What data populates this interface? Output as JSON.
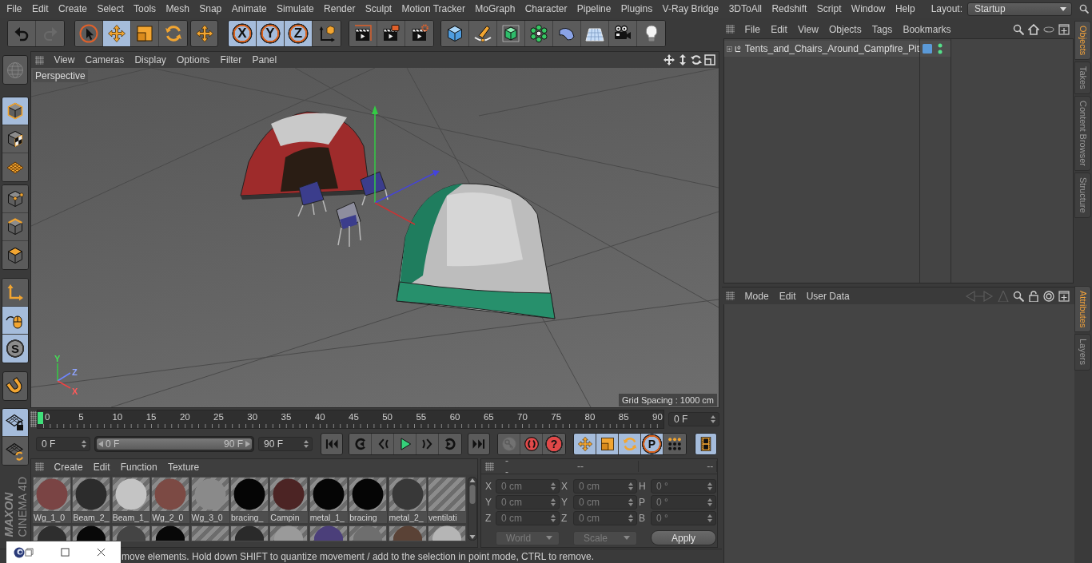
{
  "menu_bar": {
    "items": [
      "File",
      "Edit",
      "Create",
      "Select",
      "Tools",
      "Mesh",
      "Snap",
      "Animate",
      "Simulate",
      "Render",
      "Sculpt",
      "Motion Tracker",
      "MoGraph",
      "Character",
      "Pipeline",
      "Plugins",
      "V-Ray Bridge",
      "3DToAll",
      "Redshift",
      "Script",
      "Window",
      "Help"
    ],
    "layout_label": "Layout:",
    "layout_value": "Startup"
  },
  "toolbar": [
    [
      {
        "kind": "undo",
        "selected": false,
        "disabled": false
      },
      {
        "kind": "redo",
        "selected": false,
        "disabled": true
      }
    ],
    [
      {
        "kind": "select",
        "selected": false,
        "disabled": false
      },
      {
        "kind": "move",
        "selected": true,
        "disabled": false
      },
      {
        "kind": "scale",
        "selected": false,
        "disabled": false
      },
      {
        "kind": "rotate",
        "selected": false,
        "disabled": false
      }
    ],
    [
      {
        "kind": "move",
        "selected": false,
        "disabled": false
      }
    ],
    [
      {
        "kind": "axis",
        "label": "X",
        "selected": true,
        "disabled": false
      },
      {
        "kind": "axis",
        "label": "Y",
        "selected": true,
        "disabled": false
      },
      {
        "kind": "axis",
        "label": "Z",
        "selected": true,
        "disabled": false
      },
      {
        "kind": "coordinates",
        "selected": false,
        "disabled": false
      }
    ],
    [
      {
        "kind": "render-view",
        "selected": false,
        "disabled": false
      },
      {
        "kind": "render-viewer",
        "selected": false,
        "disabled": false
      },
      {
        "kind": "render-settings",
        "selected": false,
        "disabled": false
      }
    ],
    [
      {
        "kind": "cube",
        "selected": false,
        "disabled": false
      },
      {
        "kind": "pen",
        "selected": false,
        "disabled": false
      },
      {
        "kind": "subdivision",
        "selected": false,
        "disabled": false
      },
      {
        "kind": "cloner",
        "selected": false,
        "disabled": false
      },
      {
        "kind": "deformer",
        "selected": false,
        "disabled": false
      },
      {
        "kind": "floor",
        "selected": false,
        "disabled": false
      },
      {
        "kind": "camera",
        "selected": false,
        "disabled": false
      },
      {
        "kind": "light",
        "selected": false,
        "disabled": false
      }
    ]
  ],
  "side_toolbar": [
    [
      {
        "kind": "globe",
        "selected": false,
        "disabled": true
      }
    ],
    [
      {
        "kind": "model",
        "selected": true,
        "disabled": false
      },
      {
        "kind": "texture",
        "selected": false,
        "disabled": false
      },
      {
        "kind": "workplane",
        "selected": false,
        "disabled": false
      }
    ],
    [
      {
        "kind": "points",
        "selected": false,
        "disabled": false
      },
      {
        "kind": "edges",
        "selected": false,
        "disabled": false
      },
      {
        "kind": "polygons",
        "selected": false,
        "disabled": false
      }
    ],
    [
      {
        "kind": "axis-mode",
        "selected": false,
        "disabled": false
      },
      {
        "kind": "tweak",
        "selected": true,
        "disabled": false
      },
      {
        "kind": "snap",
        "label": "S",
        "selected": true,
        "disabled": false
      }
    ],
    [
      {
        "kind": "magnet",
        "selected": false,
        "disabled": false
      }
    ],
    [
      {
        "kind": "grid-lock",
        "selected": true,
        "disabled": false
      },
      {
        "kind": "grid-refresh",
        "selected": false,
        "disabled": false
      }
    ]
  ],
  "logo": {
    "brand": "MAXON",
    "product": "CINEMA 4D"
  },
  "viewport": {
    "menu": [
      "View",
      "Cameras",
      "Display",
      "Options",
      "Filter",
      "Panel"
    ],
    "camera": "Perspective",
    "grid_spacing": "Grid Spacing : 1000 cm",
    "axis_labels": [
      "Y",
      "Z",
      "X"
    ]
  },
  "timeline": {
    "level": 0,
    "ticks": [
      "0",
      "5",
      "10",
      "15",
      "20",
      "25",
      "30",
      "35",
      "40",
      "45",
      "50",
      "55",
      "60",
      "65",
      "70",
      "75",
      "80",
      "85",
      "90"
    ],
    "current_frame": "0 F"
  },
  "transport": {
    "start": "0 F",
    "range": {
      "start": "0 F",
      "end": "90 F",
      "level": 1
    },
    "end": "90 F",
    "groups": [
      [
        {
          "kind": "first",
          "selected": false,
          "disabled": false
        }
      ],
      [
        {
          "kind": "prev-key",
          "selected": false,
          "disabled": false
        },
        {
          "kind": "prev-frame",
          "selected": false,
          "disabled": false
        },
        {
          "kind": "play",
          "selected": false,
          "disabled": false
        },
        {
          "kind": "next-frame",
          "selected": false,
          "disabled": false
        },
        {
          "kind": "next-key",
          "selected": false,
          "disabled": false
        }
      ],
      [
        {
          "kind": "last",
          "selected": false,
          "disabled": false
        }
      ],
      [
        {
          "kind": "record",
          "selected": false,
          "disabled": true
        },
        {
          "kind": "autokey",
          "selected": false,
          "disabled": false
        },
        {
          "kind": "help",
          "label": "?",
          "selected": false,
          "disabled": false
        }
      ],
      [
        {
          "kind": "move",
          "selected": true,
          "disabled": false
        },
        {
          "kind": "scale",
          "selected": true,
          "disabled": false
        },
        {
          "kind": "rotate",
          "selected": true,
          "disabled": false
        },
        {
          "kind": "keyframe",
          "label": "P",
          "selected": true,
          "disabled": false
        },
        {
          "kind": "points-grid",
          "selected": false,
          "disabled": false
        }
      ],
      [
        {
          "kind": "timeline",
          "selected": true,
          "disabled": false
        }
      ]
    ]
  },
  "material_manager": {
    "menu": [
      "Create",
      "Edit",
      "Function",
      "Texture"
    ],
    "materials": [
      {
        "label": "Wg_1_0",
        "kind": "sphere",
        "color": "#7a4444"
      },
      {
        "label": "Beam_2_",
        "kind": "sphere",
        "color": "#2c2c2c"
      },
      {
        "label": "Beam_1_",
        "kind": "sphere",
        "color": "#c4c4c4"
      },
      {
        "label": "Wg_2_0",
        "kind": "sphere",
        "color": "#7c4a44"
      },
      {
        "label": "Wg_3_0",
        "kind": "sphere",
        "color": "#8a8a8a"
      },
      {
        "label": "bracing_",
        "kind": "sphere",
        "color": "#050505"
      },
      {
        "label": "Campin",
        "kind": "sphere",
        "color": "#4c2424"
      },
      {
        "label": "metal_1_",
        "kind": "sphere",
        "color": "#050505"
      },
      {
        "label": "bracing",
        "kind": "sphere",
        "color": "#050505"
      },
      {
        "label": "metal_2_",
        "kind": "sphere",
        "color": "#383838"
      },
      {
        "label": "ventilati",
        "kind": "transparent"
      },
      {
        "kind": "sphere",
        "color": "#2e2e2e"
      },
      {
        "kind": "sphere",
        "color": "#080808"
      },
      {
        "kind": "sphere",
        "color": "#444444"
      },
      {
        "kind": "sphere",
        "color": "#080808"
      },
      {
        "kind": "transparent"
      },
      {
        "kind": "sphere",
        "color": "#2a2a2a"
      },
      {
        "kind": "sphere",
        "color": "#9a9a9a"
      },
      {
        "kind": "sphere",
        "color": "#4b3f7a"
      },
      {
        "kind": "sphere",
        "color": "#6e6e6e"
      },
      {
        "kind": "sphere",
        "color": "#5a4236"
      },
      {
        "kind": "sphere",
        "color": "#b5b5b5"
      }
    ]
  },
  "coordinates": {
    "disabled": true,
    "headers": [
      "--",
      "--",
      "--"
    ],
    "rows": [
      [
        {
          "axis": "X",
          "value": "0 cm"
        },
        {
          "axis": "X",
          "value": "0 cm"
        },
        {
          "axis": "H",
          "value": "0 °"
        }
      ],
      [
        {
          "axis": "Y",
          "value": "0 cm"
        },
        {
          "axis": "Y",
          "value": "0 cm"
        },
        {
          "axis": "P",
          "value": "0 °"
        }
      ],
      [
        {
          "axis": "Z",
          "value": "0 cm"
        },
        {
          "axis": "Z",
          "value": "0 cm"
        },
        {
          "axis": "B",
          "value": "0 °"
        }
      ]
    ],
    "system": "World",
    "mode": "Scale",
    "apply": "Apply"
  },
  "status_bar": {
    "text": "move elements. Hold down SHIFT to quantize movement / add to the selection in point mode, CTRL to remove."
  },
  "object_manager": {
    "menu": [
      "File",
      "Edit",
      "View",
      "Objects",
      "Tags",
      "Bookmarks"
    ],
    "objects": [
      {
        "name": "Tents_and_Chairs_Around_Campfire_Pit",
        "expanded": false,
        "color": "#5b9ad8"
      }
    ]
  },
  "object_tabs": [
    {
      "label": "Objects",
      "selected": true
    },
    {
      "label": "Takes",
      "selected": false
    },
    {
      "label": "Content Browser",
      "selected": false
    },
    {
      "label": "Structure",
      "selected": false
    }
  ],
  "attribute_manager": {
    "menu": [
      "Mode",
      "Edit",
      "User Data"
    ]
  },
  "attribute_tabs": [
    {
      "label": "Attributes",
      "selected": true
    },
    {
      "label": "Layers",
      "selected": false
    }
  ]
}
